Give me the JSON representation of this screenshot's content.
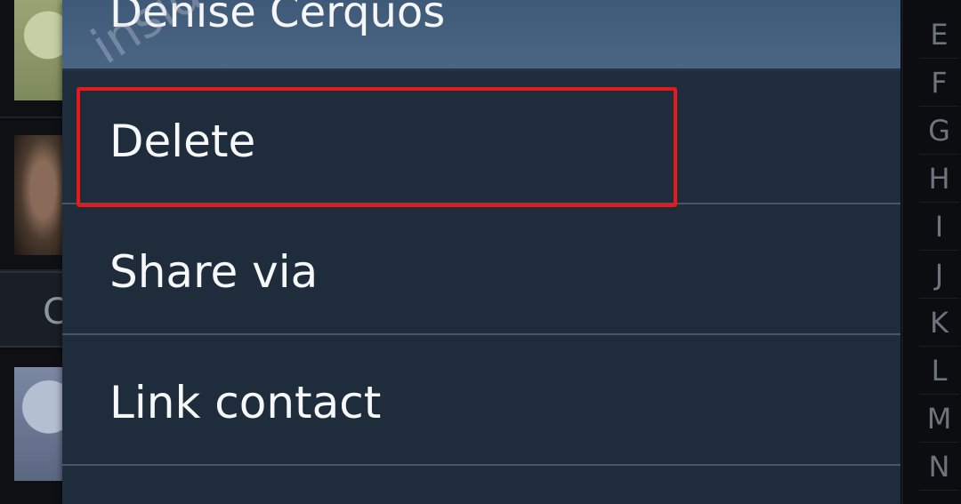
{
  "dialog": {
    "title": "Denise Cerquos",
    "items": [
      {
        "label": "Delete"
      },
      {
        "label": "Share via"
      },
      {
        "label": "Link contact"
      }
    ]
  },
  "background_list": {
    "section_letter": "C"
  },
  "index_letters": [
    "E",
    "F",
    "G",
    "H",
    "I",
    "J",
    "K",
    "L",
    "M",
    "N"
  ],
  "watermark": "inside",
  "colors": {
    "dialog_bg": "#1e2c3c",
    "title_bg": "#4b6685",
    "highlight": "#e8191b"
  }
}
